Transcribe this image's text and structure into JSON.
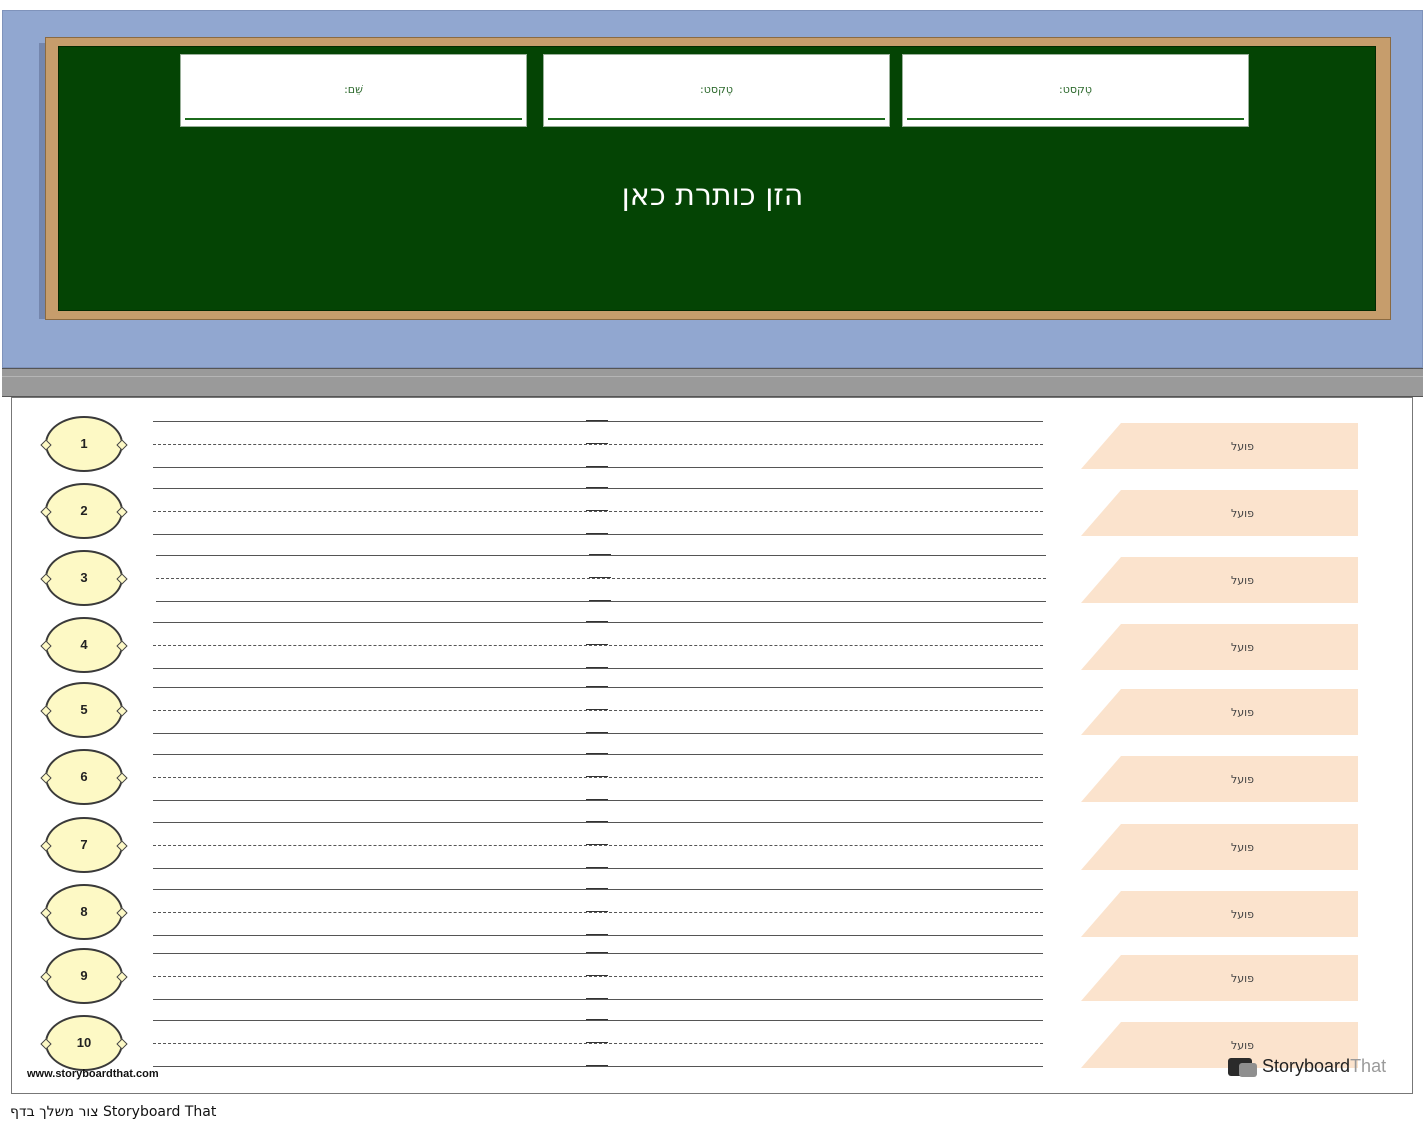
{
  "header": {
    "field_labels": [
      "שֵׁם:",
      "טֶקסט:",
      "טֶקסט:"
    ],
    "title": "הזן כותרת כאן"
  },
  "rows": [
    {
      "number": "1",
      "tag": "פועל"
    },
    {
      "number": "2",
      "tag": "פועל"
    },
    {
      "number": "3",
      "tag": "פועל"
    },
    {
      "number": "4",
      "tag": "פועל"
    },
    {
      "number": "5",
      "tag": "פועל"
    },
    {
      "number": "6",
      "tag": "פועל"
    },
    {
      "number": "7",
      "tag": "פועל"
    },
    {
      "number": "8",
      "tag": "פועל"
    },
    {
      "number": "9",
      "tag": "פועל"
    },
    {
      "number": "10",
      "tag": "פועל"
    }
  ],
  "footer": {
    "site_url": "www.storyboardthat.com",
    "brand_part1": "Storyboard",
    "brand_part2": "That",
    "credit": "צור משלך בדף Storyboard That"
  },
  "colors": {
    "board": "#044404",
    "background_panel": "#91a7d0",
    "frame": "#c69d6c",
    "number_fill": "#fdf9c5",
    "tag_fill": "#fbe3cd"
  }
}
